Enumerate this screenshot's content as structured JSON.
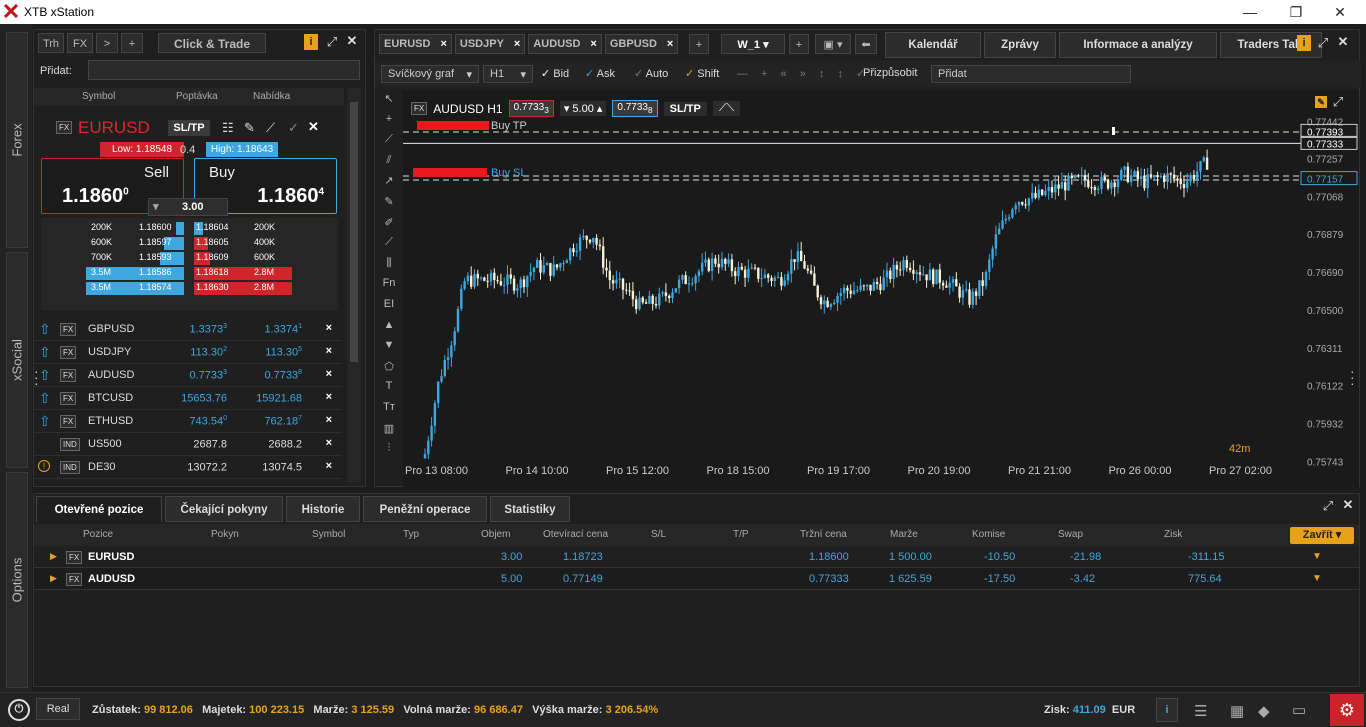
{
  "window": {
    "title": "XTB xStation"
  },
  "sidebar": {
    "tabs": [
      "Forex",
      "xSocial",
      "Options"
    ]
  },
  "left": {
    "tabs": [
      "Trh",
      "FX",
      ">",
      "+"
    ],
    "title": "Click & Trade",
    "add_label": "Přidat:",
    "columns": [
      "Symbol",
      "Poptávka",
      "Nabídka"
    ],
    "instrument": {
      "type": "FX",
      "symbol": "EURUSD",
      "sltp": "SL/TP",
      "low": "Low: 1.18548",
      "spread": "0.4",
      "high": "High: 1.18643",
      "sell_label": "Sell",
      "buy_label": "Buy",
      "sell_main": "1.1860",
      "sell_sup": "0",
      "buy_main": "1.1860",
      "buy_sup": "4",
      "volume": "3.00"
    },
    "depth_sell": [
      {
        "v": "200K",
        "p": "1.18600"
      },
      {
        "v": "600K",
        "p": "1.18597"
      },
      {
        "v": "700K",
        "p": "1.18593"
      },
      {
        "v": "3.5M",
        "p": "1.18586"
      },
      {
        "v": "3.5M",
        "p": "1.18574"
      }
    ],
    "depth_buy": [
      {
        "p": "1.18604",
        "v": "200K"
      },
      {
        "p": "1.18605",
        "v": "400K"
      },
      {
        "p": "1.18609",
        "v": "600K"
      },
      {
        "p": "1.18618",
        "v": "2.8M"
      },
      {
        "p": "1.18630",
        "v": "2.8M"
      }
    ],
    "watch": [
      {
        "type": "FX",
        "sym": "GBPUSD",
        "bid": "1.3373",
        "bid_sup": "3",
        "ask": "1.3374",
        "ask_sup": "1",
        "x": "×"
      },
      {
        "type": "FX",
        "sym": "USDJPY",
        "bid": "113.30",
        "bid_sup": "2",
        "ask": "113.30",
        "ask_sup": "5",
        "x": "×"
      },
      {
        "type": "FX",
        "sym": "AUDUSD",
        "bid": "0.7733",
        "bid_sup": "3",
        "ask": "0.7733",
        "ask_sup": "8",
        "x": "×"
      },
      {
        "type": "FX",
        "sym": "BTCUSD",
        "bid": "15653.76",
        "bid_sup": "",
        "ask": "15921.68",
        "ask_sup": "",
        "x": "×"
      },
      {
        "type": "FX",
        "sym": "ETHUSD",
        "bid": "743.54",
        "bid_sup": "0",
        "ask": "762.18",
        "ask_sup": "7",
        "x": "×"
      },
      {
        "type": "IND",
        "sym": "US500",
        "bid": "2687.8",
        "bid_sup": "",
        "ask": "2688.2",
        "ask_sup": "",
        "x": "×"
      },
      {
        "type": "IND",
        "sym": "DE30",
        "bid": "13072.2",
        "bid_sup": "",
        "ask": "13074.5",
        "ask_sup": "",
        "x": "×"
      }
    ]
  },
  "chart": {
    "symbol_tabs": [
      "EURUSD",
      "USDJPY",
      "AUDUSD",
      "GBPUSD"
    ],
    "workspace": "W_1",
    "nav_tabs": [
      "Kalendář",
      "Zprávy",
      "Informace a analýzy",
      "Traders Talk"
    ],
    "toolbar": {
      "chart_type": "Svíčkový graf",
      "timeframe": "H1",
      "bid": "Bid",
      "ask": "Ask",
      "auto": "Auto",
      "shift": "Shift",
      "fit": "Přizpůsobit",
      "add_placeholder": "Přidat"
    },
    "header": {
      "type": "FX",
      "symbol": "AUDUSD H1",
      "sell": "0.7733",
      "sell_sup": "3",
      "vol": "5.00",
      "buy": "0.7733",
      "buy_sup": "8",
      "sltp": "SL/TP"
    },
    "buy_tp": "Buy TP",
    "buy_sl": "Buy SL",
    "countdown": "42m",
    "price_labels": [
      "0.77442",
      "0.77393",
      "0.77333",
      "0.77257",
      "0.77157",
      "0.77068",
      "0.76879",
      "0.76690",
      "0.76500",
      "0.76311",
      "0.76122",
      "0.75932",
      "0.75743"
    ],
    "time_labels": [
      "Pro 13 08:00",
      "Pro 14 10:00",
      "Pro 15 12:00",
      "Pro 18 15:00",
      "Pro 19 17:00",
      "Pro 20 19:00",
      "Pro 21 21:00",
      "Pro 26 00:00",
      "Pro 27 02:00"
    ]
  },
  "chart_data": {
    "type": "candlestick",
    "symbol": "AUDUSD",
    "timeframe": "H1",
    "ylim": [
      0.7574,
      0.7745
    ],
    "x": [
      "Pro 13 08:00",
      "Pro 14 10:00",
      "Pro 15 12:00",
      "Pro 18 15:00",
      "Pro 19 17:00",
      "Pro 20 19:00",
      "Pro 21 21:00",
      "Pro 26 00:00",
      "Pro 27 02:00"
    ],
    "close_approx": [
      0.759,
      0.7673,
      0.7652,
      0.7665,
      0.7658,
      0.766,
      0.7712,
      0.7722,
      0.7733
    ],
    "lines": {
      "buy_tp": 0.7739,
      "current": 0.7733,
      "buy_sl": 0.7716
    }
  },
  "bottom": {
    "tabs": [
      "Otevřené pozice",
      "Čekající pokyny",
      "Historie",
      "Peněžní operace",
      "Statistiky"
    ],
    "close_btn": "Zavřít",
    "columns": [
      "Pozice",
      "Pokyn",
      "Symbol",
      "Typ",
      "Objem",
      "Otevírací cena",
      "S/L",
      "T/P",
      "Tržní cena",
      "Marže",
      "Komise",
      "Swap",
      "Zisk"
    ],
    "rows": [
      {
        "type": "FX",
        "sym": "EURUSD",
        "vol": "3.00",
        "open": "1.18723",
        "market": "1.18600",
        "margin": "1 500.00",
        "comm": "-10.50",
        "swap": "-21.98",
        "profit": "-311.15"
      },
      {
        "type": "FX",
        "sym": "AUDUSD",
        "vol": "5.00",
        "open": "0.77149",
        "market": "0.77333",
        "margin": "1 625.59",
        "comm": "-17.50",
        "swap": "-3.42",
        "profit": "775.64"
      }
    ]
  },
  "status": {
    "mode": "Real",
    "balance_l": "Zůstatek:",
    "balance": "99 812.06",
    "equity_l": "Majetek:",
    "equity": "100 223.15",
    "margin_l": "Marže:",
    "margin": "3 125.59",
    "free_l": "Volná marže:",
    "free": "96 686.47",
    "level_l": "Výška marže:",
    "level": "3 206.54%",
    "profit_l": "Zisk:",
    "profit": "411.09",
    "currency": "EUR"
  }
}
